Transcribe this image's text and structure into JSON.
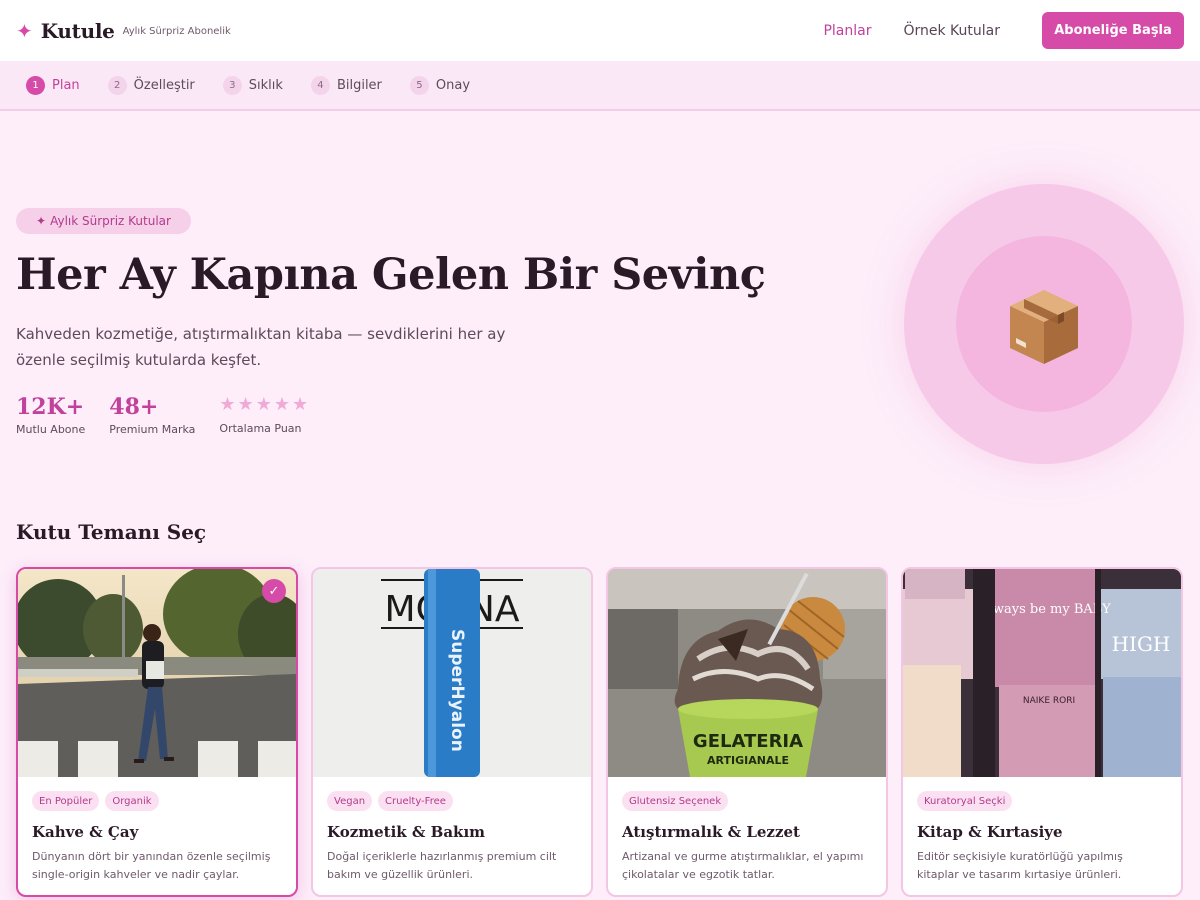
{
  "header": {
    "logo_name": "Kutule",
    "logo_tag": "Aylık Sürpriz Abonelik",
    "nav": [
      {
        "label": "Planlar",
        "active": true
      },
      {
        "label": "Örnek Kutular",
        "active": false
      }
    ],
    "cta_label": "Aboneliğe Başla"
  },
  "steps": [
    {
      "num": "1",
      "label": "Plan",
      "active": true
    },
    {
      "num": "2",
      "label": "Özelleştir",
      "active": false
    },
    {
      "num": "3",
      "label": "Sıklık",
      "active": false
    },
    {
      "num": "4",
      "label": "Bilgiler",
      "active": false
    },
    {
      "num": "5",
      "label": "Onay",
      "active": false
    }
  ],
  "hero": {
    "badge": "Aylık Sürpriz Kutular",
    "title": "Her Ay Kapına Gelen Bir Sevinç",
    "subtitle": "Kahveden kozmetiğe, atıştırmalıktan kitaba — sevdiklerini her ay özenle seçilmiş kutularda keşfet.",
    "stats": [
      {
        "value": "12K+",
        "label": "Mutlu Abone"
      },
      {
        "value": "48+",
        "label": "Premium Marka"
      }
    ],
    "rating": {
      "stars": 5,
      "label": "Ortalama Puan"
    }
  },
  "themes": {
    "section_title": "Kutu Temanı Seç",
    "cards": [
      {
        "title": "Kahve & Çay",
        "tags": [
          "En Popüler",
          "Organik"
        ],
        "desc": "Dünyanın dört bir yanından özenle seçilmiş single-origin kahveler ve nadir çaylar.",
        "selected": true
      },
      {
        "title": "Kozmetik & Bakım",
        "tags": [
          "Vegan",
          "Cruelty-Free"
        ],
        "desc": "Doğal içeriklerle hazırlanmış premium cilt bakım ve güzellik ürünleri.",
        "selected": false
      },
      {
        "title": "Atıştırmalık & Lezzet",
        "tags": [
          "Glutensiz Seçenek"
        ],
        "desc": "Artizanal ve gurme atıştırmalıklar, el yapımı çikolatalar ve egzotik tatlar.",
        "selected": false
      },
      {
        "title": "Kitap & Kırtasiye",
        "tags": [
          "Kuratoryal Seçki"
        ],
        "desc": "Editör seçkisiyle kuratörlüğü yapılmış kitaplar ve tasarım kırtasiye ürünleri.",
        "selected": false
      }
    ],
    "image_text": {
      "cosmetic_brand": "MOANA",
      "cosmetic_product": "SuperHyalon",
      "gelato_line1": "GELATERIA",
      "gelato_line2": "ARTIGIANALE",
      "book_title": "Always be my BABY",
      "book_title2": "HIGH",
      "book_author": "NAIKE RORI"
    }
  },
  "colors": {
    "accent": "#d64aa8",
    "background": "#fdeefa",
    "text": "#2a1a28"
  }
}
